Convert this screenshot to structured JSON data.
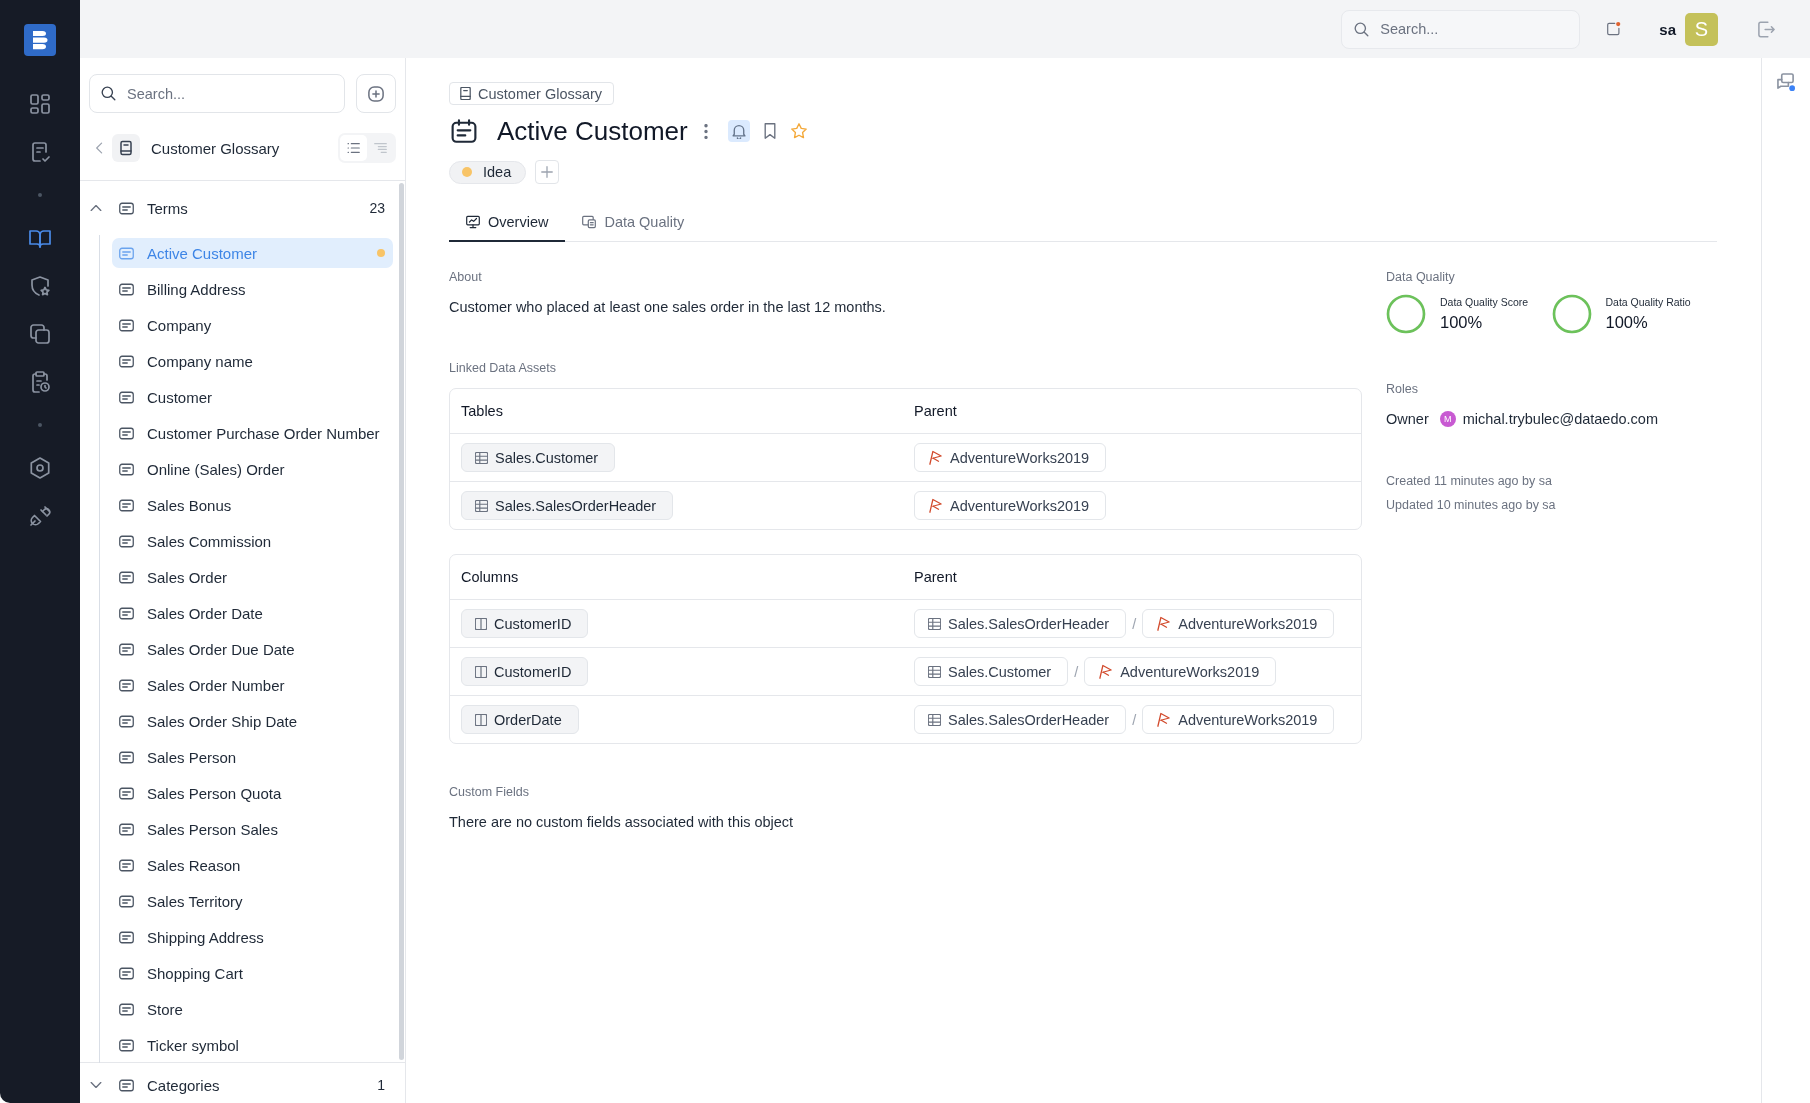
{
  "rail": {
    "items": [
      {
        "kind": "button",
        "selected": false
      },
      {
        "kind": "button",
        "selected": false
      },
      {
        "kind": "divider"
      },
      {
        "kind": "button",
        "selected": true
      },
      {
        "kind": "button",
        "selected": false
      },
      {
        "kind": "button",
        "selected": false
      },
      {
        "kind": "button",
        "selected": false
      },
      {
        "kind": "divider"
      },
      {
        "kind": "button",
        "selected": false
      },
      {
        "kind": "button",
        "selected": false
      }
    ]
  },
  "top_bar": {
    "search": {
      "placeholder": "Search..."
    },
    "user": {
      "name": "sa",
      "avatar": "S"
    }
  },
  "sidebar": {
    "search": {
      "placeholder": "Search..."
    },
    "glossary": {
      "title": "Customer Glossary"
    },
    "view_toggle": [
      {
        "selected": true
      },
      {
        "selected": false
      }
    ],
    "tree": [
      {
        "label": "Terms",
        "count": "23",
        "expanded": true,
        "children": [
          {
            "label": "Active Customer",
            "selected": true,
            "color": "#f8c467"
          },
          {
            "label": "Billing Address",
            "selected": false
          },
          {
            "label": "Company",
            "selected": false
          },
          {
            "label": "Company name",
            "selected": false
          },
          {
            "label": "Customer",
            "selected": false
          },
          {
            "label": "Customer Purchase Order Number",
            "selected": false
          },
          {
            "label": "Online (Sales) Order",
            "selected": false
          },
          {
            "label": "Sales Bonus",
            "selected": false
          },
          {
            "label": "Sales Commission",
            "selected": false
          },
          {
            "label": "Sales Order",
            "selected": false
          },
          {
            "label": "Sales Order Date",
            "selected": false
          },
          {
            "label": "Sales Order Due Date",
            "selected": false
          },
          {
            "label": "Sales Order Number",
            "selected": false
          },
          {
            "label": "Sales Order Ship Date",
            "selected": false
          },
          {
            "label": "Sales Person",
            "selected": false
          },
          {
            "label": "Sales Person Quota",
            "selected": false
          },
          {
            "label": "Sales Person Sales",
            "selected": false
          },
          {
            "label": "Sales Reason",
            "selected": false
          },
          {
            "label": "Sales Territory",
            "selected": false
          },
          {
            "label": "Shipping Address",
            "selected": false
          },
          {
            "label": "Shopping Cart",
            "selected": false
          },
          {
            "label": "Store",
            "selected": false
          },
          {
            "label": "Ticker symbol",
            "selected": false
          }
        ]
      },
      {
        "label": "Categories",
        "count": "1",
        "expanded": false
      }
    ]
  },
  "header": {
    "breadcrumb": "Customer Glossary",
    "title": "Active Customer",
    "watching": true,
    "bookmarked": false,
    "starred": false,
    "tags": [
      {
        "label": "Idea",
        "color": "#f8c467"
      }
    ]
  },
  "tabs": [
    {
      "label": "Overview",
      "selected": true
    },
    {
      "label": "Data Quality",
      "selected": false
    }
  ],
  "overview": {
    "about": {
      "label": "About",
      "text": "Customer who placed at least one sales order in the last 12 months."
    },
    "linked_assets": {
      "label": "Linked Data Assets",
      "tables": [
        {
          "columns": [
            "Tables",
            "Parent"
          ],
          "rows": [
            {
              "item": {
                "kind": "table",
                "label": "Sales.Customer"
              },
              "parent": [
                {
                  "kind": "database",
                  "label": "AdventureWorks2019"
                }
              ]
            },
            {
              "item": {
                "kind": "table",
                "label": "Sales.SalesOrderHeader"
              },
              "parent": [
                {
                  "kind": "database",
                  "label": "AdventureWorks2019"
                }
              ]
            }
          ]
        },
        {
          "columns": [
            "Columns",
            "Parent"
          ],
          "rows": [
            {
              "item": {
                "kind": "column",
                "label": "CustomerID"
              },
              "parent": [
                {
                  "kind": "table",
                  "label": "Sales.SalesOrderHeader"
                },
                {
                  "kind": "separator",
                  "label": "/"
                },
                {
                  "kind": "database",
                  "label": "AdventureWorks2019"
                }
              ]
            },
            {
              "item": {
                "kind": "column",
                "label": "CustomerID"
              },
              "parent": [
                {
                  "kind": "table",
                  "label": "Sales.Customer"
                },
                {
                  "kind": "separator",
                  "label": "/"
                },
                {
                  "kind": "database",
                  "label": "AdventureWorks2019"
                }
              ]
            },
            {
              "item": {
                "kind": "column",
                "label": "OrderDate"
              },
              "parent": [
                {
                  "kind": "table",
                  "label": "Sales.SalesOrderHeader"
                },
                {
                  "kind": "separator",
                  "label": "/"
                },
                {
                  "kind": "database",
                  "label": "AdventureWorks2019"
                }
              ]
            }
          ]
        }
      ]
    },
    "custom_fields": {
      "label": "Custom Fields",
      "text": "There are no custom fields associated with this object"
    }
  },
  "side_panel": {
    "data_quality": {
      "label": "Data Quality",
      "metrics": [
        {
          "label": "Data Quality Score",
          "value": "100%",
          "level": 1
        },
        {
          "label": "Data Quality Ratio",
          "value": "100%",
          "level": 1
        }
      ]
    },
    "roles": {
      "label": "Roles",
      "items": [
        {
          "role": "Owner",
          "avatar": "M",
          "user": "michal.trybulec@dataedo.com"
        }
      ]
    },
    "history": [
      "Created 11 minutes ago by sa",
      "Updated 10 minutes ago by sa"
    ]
  }
}
